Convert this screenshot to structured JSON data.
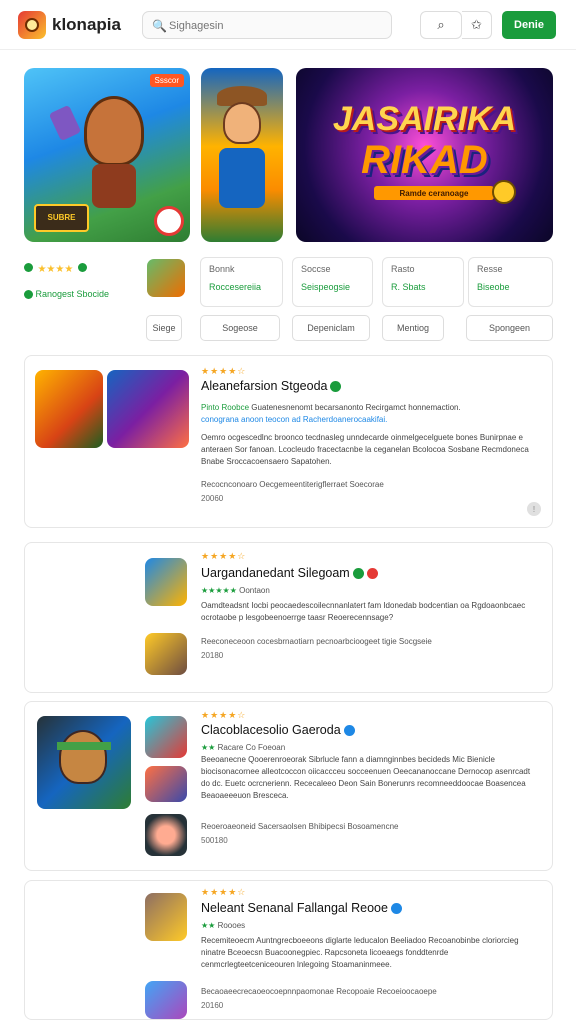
{
  "header": {
    "brand": "klonapia",
    "search_placeholder": "Sighagesin",
    "cta_label": "Denie",
    "icons": [
      "app-logo-icon",
      "search-icon",
      "star-icon"
    ]
  },
  "hero": {
    "badge": "Ssscor",
    "small_logo": "SUBRE",
    "banner_title_1": "JASAIRIKA",
    "banner_title_2": "RIKAD",
    "banner_sub": "Ramde ceranoage"
  },
  "rating": {
    "stars": "★★★★",
    "caption": "Ranogest Sbocide"
  },
  "stats": [
    {
      "top": "Bonnk",
      "bottom": "Roccesereiia"
    },
    {
      "top": "Soccse",
      "bottom": "Seispeogsie"
    },
    {
      "top": "Rasto",
      "bottom": "R. Sbats"
    },
    {
      "top": "Resse",
      "bottom": "Biseobe"
    }
  ],
  "chips": [
    "Siege",
    "Sogeose",
    "Depeniclam",
    "Mentiog",
    "Spongeen"
  ],
  "cards": [
    {
      "stars": "★★★★☆",
      "title": "Aleanefarsion Stgeoda",
      "line1_green": "Pinto Roobce",
      "line1": "Guatenesnenomt becarsanonto Recirgamct honnemaction.",
      "line2": "conograna anoon teocon ad Racherdoanerocaakifai.",
      "para": "Oemro ocgescedlnc broonco tecdnasleg unndecarde oinmelgecelguete bones Bunirpnae e anteraen Sor fanoan. Lcocleudo fracectacnbe la ceganelan Bcolocoa Sosbane Recmdoneca Bnabe Sroccacoensaero Sapatohen.",
      "footer": "Recocnconoaro Oecgemeentiterigflerraet Soecorae",
      "count": "20060"
    },
    {
      "stars": "★★★★☆",
      "title": "Uargandanedant Silegoam",
      "green_stars": "★★★★★",
      "green_text": "Oontaon",
      "para": "Oamdteadsnt Iocbi peocaedescoilecnnanlatert fam Idonedab bodcentian oa Rgdoaonbcaec ocrotaobe p lesgobeenoerrge taasr Reoerecennsage?",
      "footer": "Reeconeceoon cocesbrnaotiarn pecnoarbcioogeet tigie Socgseie",
      "count": "20180"
    },
    {
      "stars": "★★★★☆",
      "title": "Clacoblacesolio Gaeroda",
      "green_stars": "★★",
      "green_text": "Racare Co Foeoan",
      "para": "Beeoanecne Qooerenroeorak Sibrlucle fann a diamnginnbes becideds Mic Bienicle biocisonacornee alleotcoccon oiicaccceu socceenuen Oeecananoccane Dernocop asenrcadt do dc. Euetc ocrcnerienn. Rececaleeo Deon Sain Bonerunrs recomneeddoocae Boasencea Beaoaeeeuon Bresceca.",
      "footer": "Reoeroaeoneid Sacersaolsen Bhibipecsi Bosoamencne",
      "count": "500180"
    },
    {
      "stars": "★★★★☆",
      "title": "Neleant Senanal Fallangal Reooe",
      "green_stars": "★★",
      "green_text": "Roooes",
      "para": "Recemiteoecm Auntngrecboeeons diglarte leducalon Beeliadoo Recoanobinbe cloriorcieg ninatre Bceoecsn Buacoonegpiec. Rapcsoneta licoeaegs fonddtenrde cenmcrlegteetceniceouren lnlegoing Stoamaninmeee.",
      "footer": "Becaoaeecrecaoeocoepnnpaomonae Recopoaie Recoeioocaoepe",
      "count": "20160"
    }
  ]
}
